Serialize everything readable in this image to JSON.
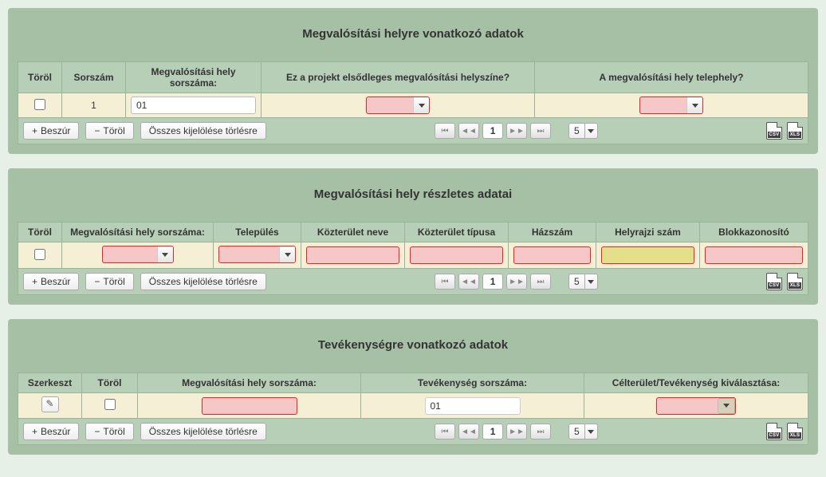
{
  "panels": {
    "loc": {
      "title": "Megvalósítási helyre vonatkozó adatok",
      "headers": {
        "del": "Töröl",
        "seq": "Sorszám",
        "locseq": "Megvalósítási hely sorszáma:",
        "primary": "Ez a projekt elsődleges megvalósítási helyszíne?",
        "site": "A megvalósítási hely telephely?"
      },
      "row": {
        "seq": "1",
        "locseq": "01"
      }
    },
    "detail": {
      "title": "Megvalósítási hely részletes adatai",
      "headers": {
        "del": "Töröl",
        "locseq": "Megvalósítási hely sorszáma:",
        "town": "Település",
        "street": "Közterület neve",
        "type": "Közterület típusa",
        "house": "Házszám",
        "lot": "Helyrajzi szám",
        "block": "Blokkazonosító"
      }
    },
    "activity": {
      "title": "Tevékenységre vonatkozó adatok",
      "headers": {
        "edit": "Szerkeszt",
        "del": "Töröl",
        "locseq": "Megvalósítási hely sorszáma:",
        "actseq": "Tevékenység sorszáma:",
        "target": "Célterület/Tevékenység kiválasztása:"
      },
      "row": {
        "actseq": "01"
      }
    }
  },
  "controls": {
    "insert": "Beszúr",
    "delete": "Töröl",
    "selectAll": "Összes kijelölése törlésre",
    "page": "1",
    "pageSize": "5"
  },
  "export": {
    "csv": "CSV",
    "xls": "XLS"
  }
}
